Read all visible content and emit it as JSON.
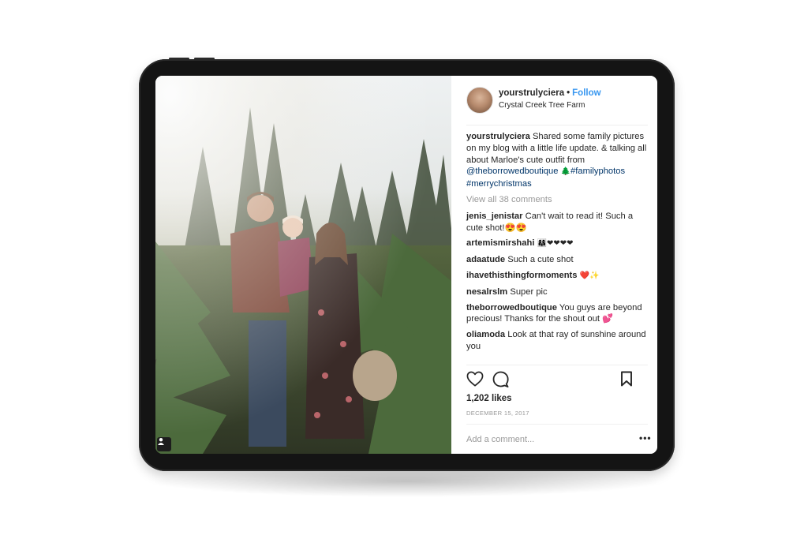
{
  "post": {
    "username": "yourstrulyciera",
    "follow_label": "Follow",
    "location": "Crystal Creek Tree Farm",
    "caption": {
      "user": "yourstrulyciera",
      "text": "Shared some family pictures on my blog with a little life update. & talking all about Marloe's cute outfit from",
      "mention": "@theborrowedboutique",
      "emoji": "🌲",
      "tags": "#familyphotos #merrychristmas"
    },
    "view_all": "View all 38 comments",
    "comments": [
      {
        "user": "jenis_jenistar",
        "text": "Can't wait to read it! Such a cute shot!😍😍"
      },
      {
        "user": "artemismirshahi",
        "text": "👩‍👩‍👧❤❤❤❤"
      },
      {
        "user": "adaatude",
        "text": "Such a cute shot"
      },
      {
        "user": "ihavethisthingformoments",
        "text": "❤️✨"
      },
      {
        "user": "nesalrslm",
        "text": "Super pic"
      },
      {
        "user": "theborrowedboutique",
        "text": "You guys are beyond precious! Thanks for the shout out 💕"
      },
      {
        "user": "oliamoda",
        "text": "Look at that ray of sunshine around you"
      }
    ],
    "likes": "1,202 likes",
    "date": "DECEMBER 15, 2017",
    "add_comment_placeholder": "Add a comment...",
    "more_label": "•••"
  },
  "icons": {
    "like": "heart-icon",
    "comment": "comment-icon",
    "save": "bookmark-icon",
    "tagged_user": "user-icon"
  },
  "colors": {
    "accent": "#3897f0",
    "link": "#003569",
    "muted": "#999999",
    "text": "#262626"
  }
}
